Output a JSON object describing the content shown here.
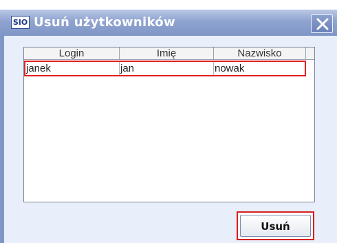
{
  "window": {
    "title": "Usuń użytkowników",
    "app_icon_text": "SIO"
  },
  "table": {
    "columns": [
      "Login",
      "Imię",
      "Nazwisko"
    ],
    "rows": [
      {
        "login": "janek",
        "imie": "jan",
        "nazwisko": "nowak",
        "selected": true
      }
    ]
  },
  "actions": {
    "delete_label": "Usuń"
  },
  "colors": {
    "titlebar": "#8fa3cf",
    "client_background": "#e8eefa",
    "highlight_border": "#e02020"
  }
}
